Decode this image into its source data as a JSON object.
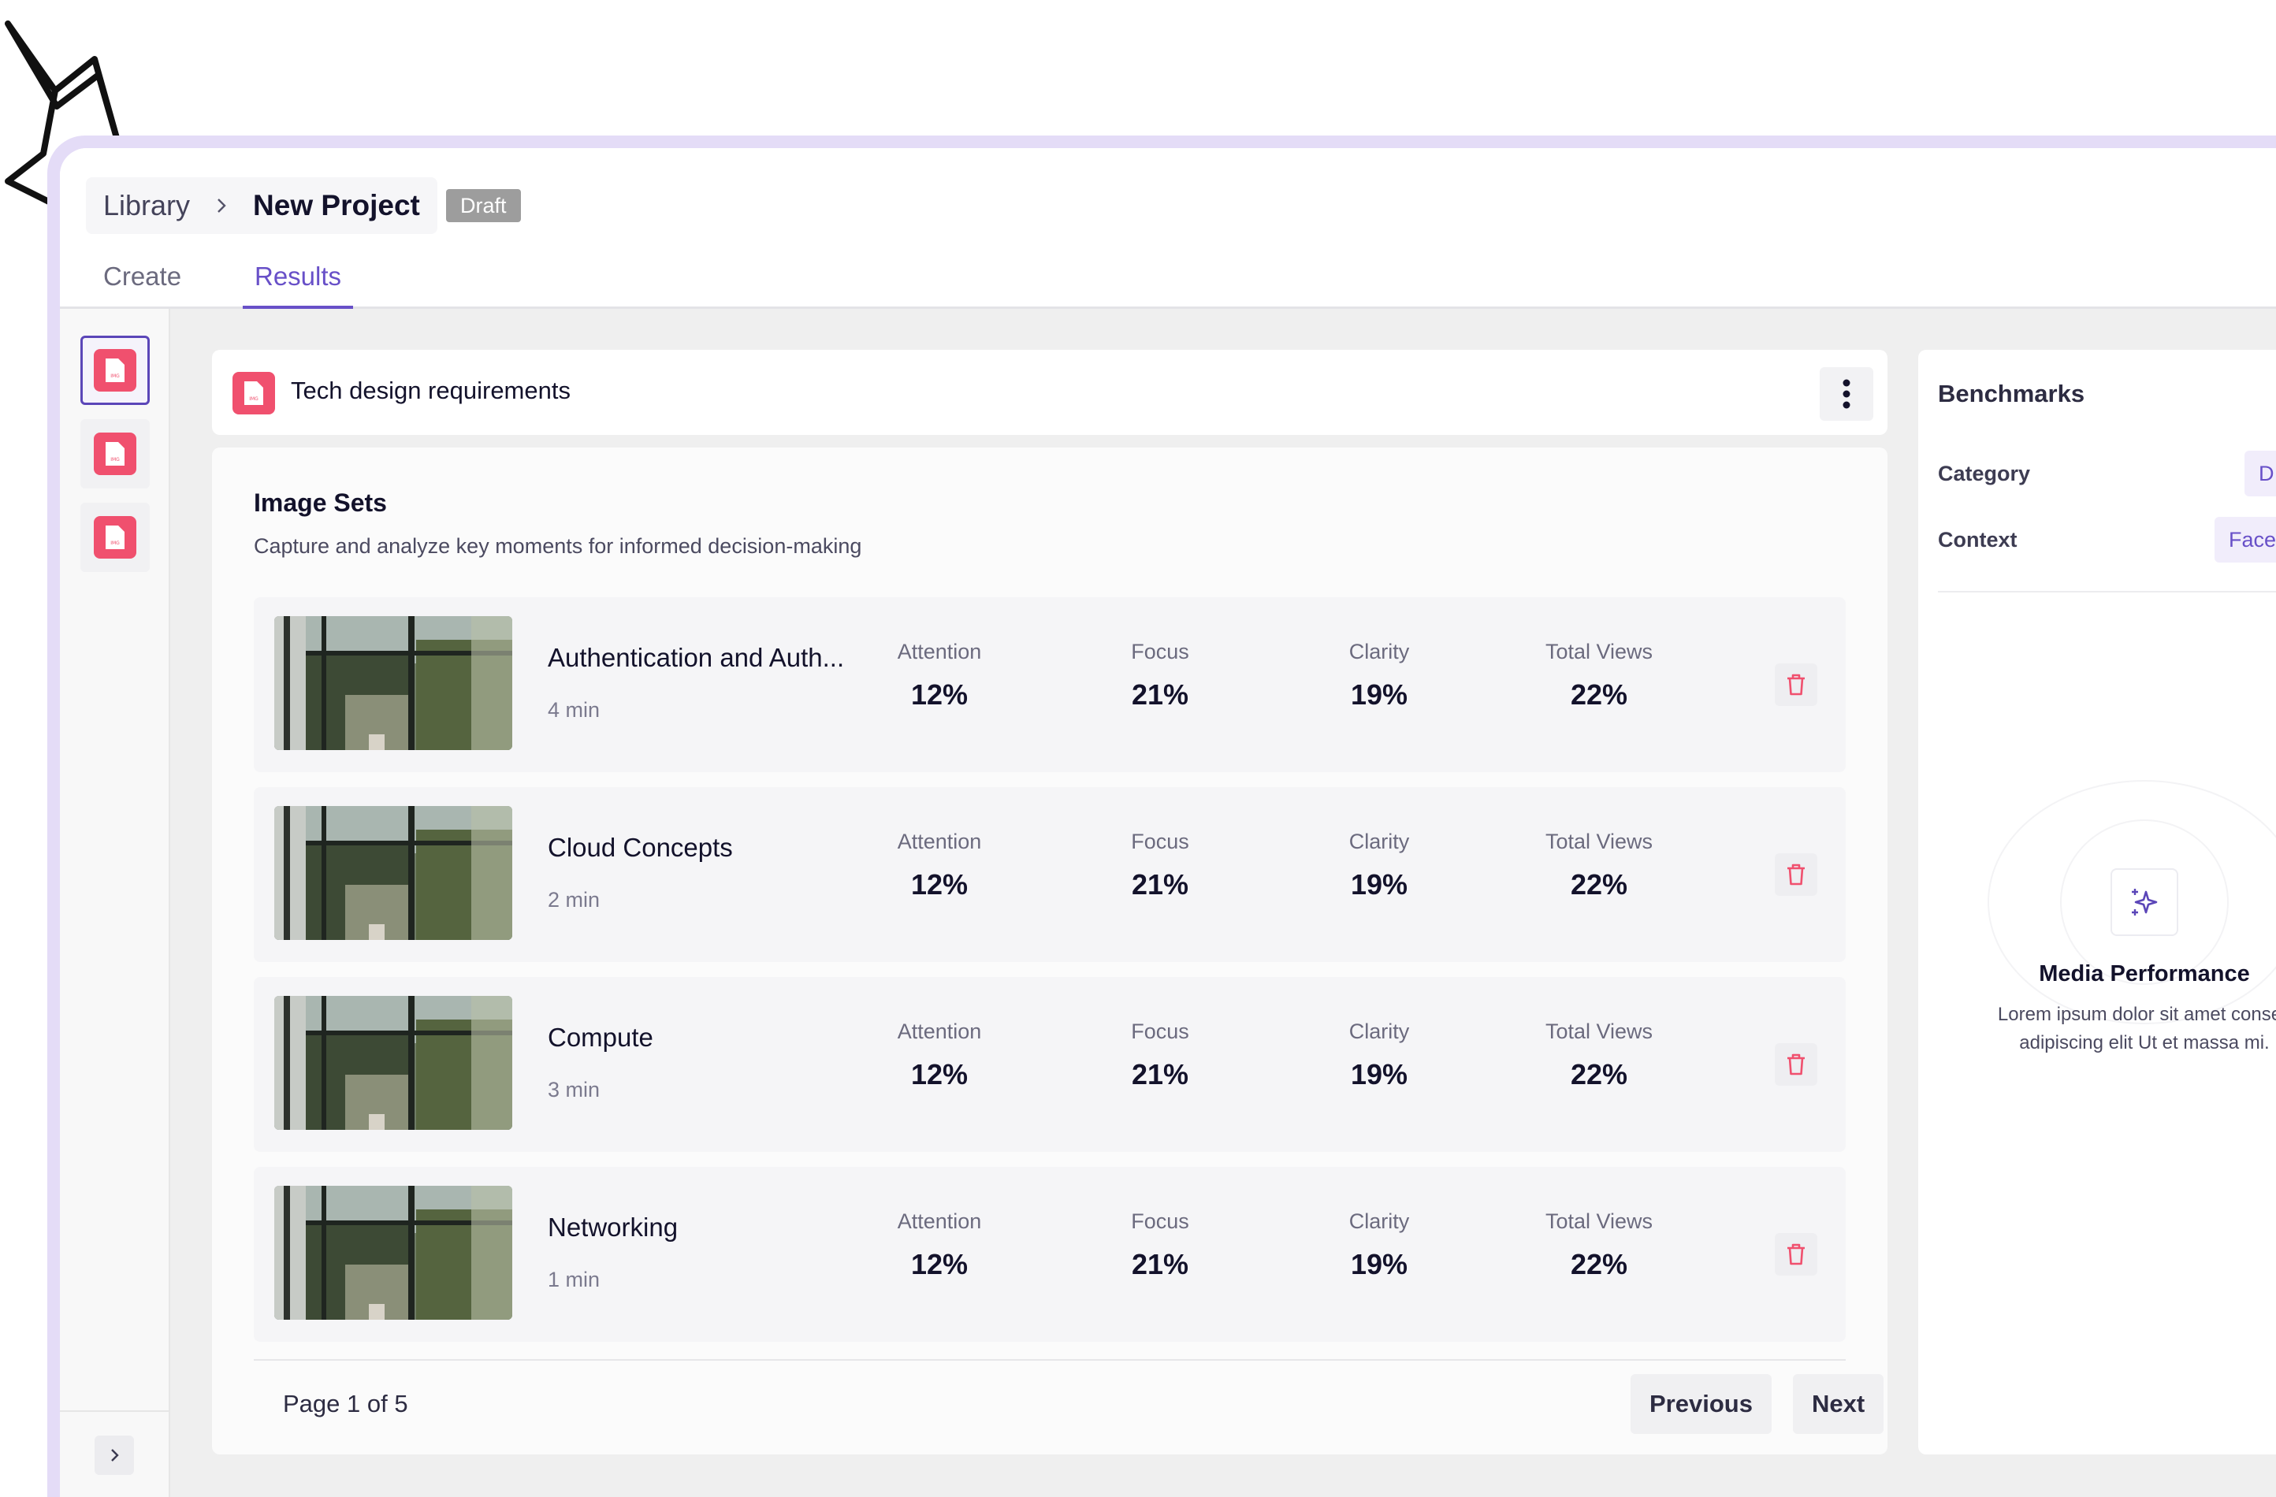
{
  "breadcrumb": {
    "library": "Library",
    "current": "New Project"
  },
  "badge": "Draft",
  "tabs": [
    {
      "label": "Create"
    },
    {
      "label": "Results"
    }
  ],
  "document": {
    "title": "Tech design requirements"
  },
  "image_sets": {
    "title": "Image Sets",
    "description": "Capture and analyze key moments for informed decision-making",
    "metric_labels": [
      "Attention",
      "Focus",
      "Clarity",
      "Total Views"
    ],
    "rows": [
      {
        "title": "Authentication and Auth...",
        "duration": "4 min",
        "metrics": [
          "12%",
          "21%",
          "19%",
          "22%"
        ]
      },
      {
        "title": "Cloud Concepts",
        "duration": "2 min",
        "metrics": [
          "12%",
          "21%",
          "19%",
          "22%"
        ]
      },
      {
        "title": "Compute",
        "duration": "3 min",
        "metrics": [
          "12%",
          "21%",
          "19%",
          "22%"
        ]
      },
      {
        "title": "Networking",
        "duration": "1 min",
        "metrics": [
          "12%",
          "21%",
          "19%",
          "22%"
        ]
      }
    ]
  },
  "pagination": {
    "info": "Page 1 of 5",
    "previous": "Previous",
    "next": "Next"
  },
  "benchmarks": {
    "title": "Benchmarks",
    "category_label": "Category",
    "category_value": "D",
    "context_label": "Context",
    "context_value": "Face",
    "media_title": "Media Performance",
    "media_desc_line1": "Lorem ipsum dolor sit amet consec",
    "media_desc_line2": "adipiscing elit Ut et massa mi."
  },
  "colors": {
    "accent": "#6850c8",
    "danger": "#f0506e",
    "frame": "#e4dcf7"
  },
  "icons": [
    "chevron-right-icon",
    "file-image-icon",
    "kebab-icon",
    "trash-icon",
    "sparkle-icon"
  ]
}
